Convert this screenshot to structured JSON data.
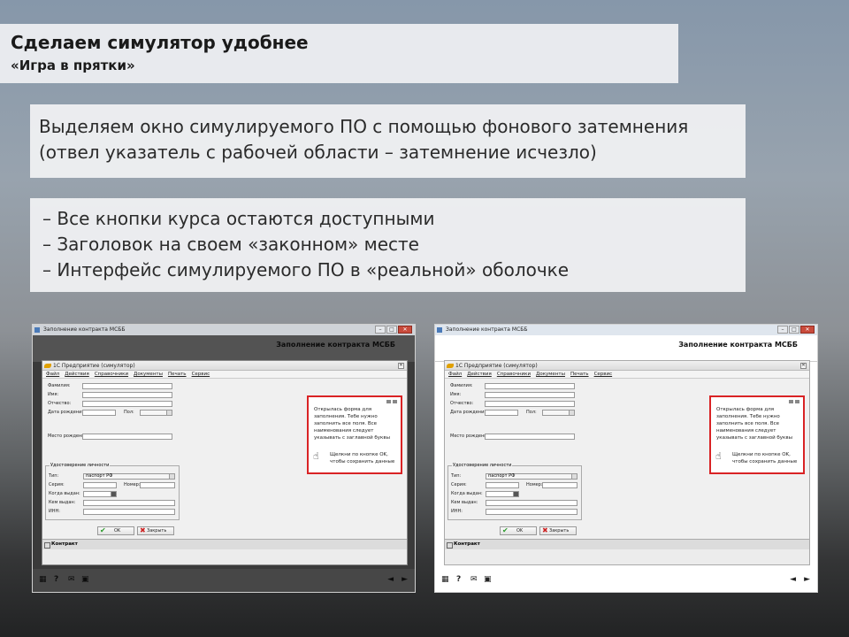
{
  "header": {
    "title": "Сделаем симулятор удобнее",
    "subtitle": "«Игра в прятки»"
  },
  "description": {
    "line1": "Выделяем окно симулируемого ПО с помощью фонового затемнения",
    "line2": "(отвел указатель с рабочей области – затемнение исчезло)"
  },
  "bullets": [
    "– Все кнопки курса остаются доступными",
    "– Заголовок на своем «законном» месте",
    "– Интерфейс симулируемого ПО в «реальной» оболочке"
  ],
  "screenshot": {
    "window_title": "Заполнение контракта МСББ",
    "course_header": "Заполнение контракта МСББ",
    "sim_title": "1С Предприятие (симулятор)",
    "menu": [
      "Файл",
      "Действия",
      "Справочники",
      "Документы",
      "Печать",
      "Сервис"
    ],
    "fields": {
      "surname": "Фамилия:",
      "name": "Имя:",
      "patronymic": "Отчество:",
      "birth_date": "Дата рождения:",
      "gender": "Пол:",
      "birth_place": "Место рождения:"
    },
    "id_group": {
      "title": "Удостоверение личности",
      "type_label": "Тип:",
      "type_value": "паспорт РФ",
      "series": "Серия:",
      "number": "Номер:",
      "issued_when": "Когда выдан:",
      "issued_by": "Кем выдан:",
      "inn": "ИНН:"
    },
    "buttons": {
      "ok": "OK",
      "close": "Закрыть"
    },
    "hint": {
      "text": "Открылась форма для заполнения. Тебе нужно заполнить все поля. Все наименования следует указывать с заглавной буквы",
      "action": "Щелкни по кнопке OK, чтобы сохранить данные"
    },
    "footer": "Контракт"
  },
  "colors": {
    "hint_border": "#d92325",
    "dimmed_background": "#3a3a3a",
    "normal_background": "#ffffff"
  }
}
